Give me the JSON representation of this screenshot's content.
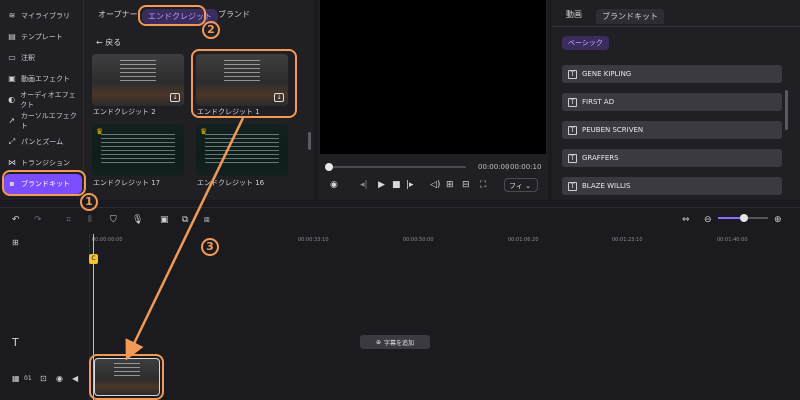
{
  "sidebar": {
    "items": [
      {
        "label": "マイライブラリ",
        "icon": "layers-icon"
      },
      {
        "label": "テンプレート",
        "icon": "template-icon"
      },
      {
        "label": "注釈",
        "icon": "comment-icon"
      },
      {
        "label": "動画エフェクト",
        "icon": "video-effect-icon"
      },
      {
        "label": "オーディオエフェクト",
        "icon": "audio-effect-icon"
      },
      {
        "label": "カーソルエフェクト",
        "icon": "cursor-icon"
      },
      {
        "label": "パンとズーム",
        "icon": "pan-zoom-icon"
      },
      {
        "label": "トランジション",
        "icon": "transition-icon"
      },
      {
        "label": "ブランドキット",
        "icon": "brand-kit-icon"
      }
    ]
  },
  "library": {
    "tabs": [
      "オープナー",
      "エンドクレジット",
      "ブランド"
    ],
    "back_label": "戻る",
    "thumbs": [
      {
        "label": "エンドクレジット 2"
      },
      {
        "label": "エンドクレジット 1"
      },
      {
        "label": "エンドクレジット 17"
      },
      {
        "label": "エンドクレジット 16"
      }
    ]
  },
  "preview": {
    "time_current": "00:00:00",
    "time_total": "00:00:10",
    "fit_label": "フィ"
  },
  "props": {
    "tabs": [
      "動画",
      "ブランドキット"
    ],
    "basic_label": "ベーシック",
    "credits": [
      "GENE KIPLING",
      "FIRST AD",
      "PEUBEN SCRIVEN",
      "GRAFFERS",
      "BLAZE WILLIS"
    ]
  },
  "timeline": {
    "ruler": [
      "00:00:00:00",
      "00:00:33:10",
      "00:00:50:00",
      "00:01:06:20",
      "00:01:23:10",
      "00:01:40:00"
    ],
    "add_subtitle": "字幕を追加",
    "track_index": "01",
    "playhead_tag": "C"
  },
  "annotations": {
    "step1": "1",
    "step2": "2",
    "step3": "3",
    "color": "#f29a55"
  },
  "colors": {
    "accent": "#7c4dff",
    "playhead": "#f2c230"
  }
}
